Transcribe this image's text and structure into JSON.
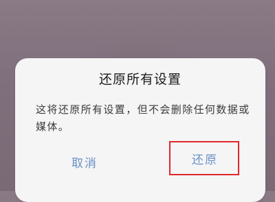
{
  "dialog": {
    "title": "还原所有设置",
    "message": "这将还原所有设置，但不会删除任何数据或媒体。",
    "buttons": {
      "cancel": "取消",
      "restore": "还原"
    }
  },
  "colors": {
    "background": "#7f6f7c",
    "dialog": "#f5f5f5",
    "button_text": "#6a8fc7",
    "highlight": "#e0262b"
  }
}
